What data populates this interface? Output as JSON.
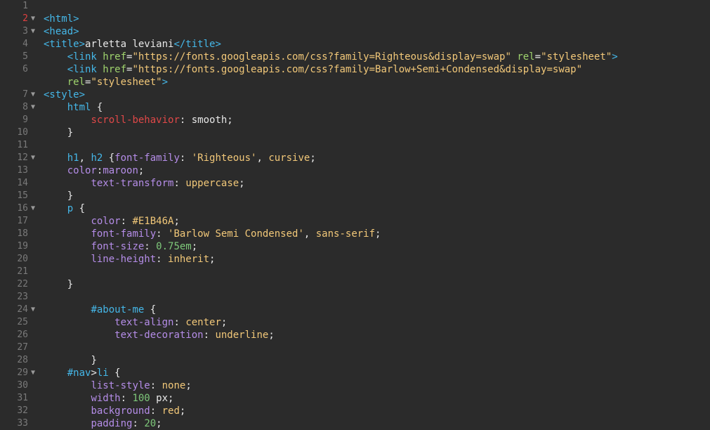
{
  "editor": {
    "active_line": 2,
    "lines": [
      {
        "n": "1",
        "fold": false,
        "indent": 0,
        "tokens": []
      },
      {
        "n": "2",
        "fold": true,
        "indent": 0,
        "tokens": [
          {
            "t": "tag",
            "v": "<html>"
          }
        ]
      },
      {
        "n": "3",
        "fold": true,
        "indent": 0,
        "tokens": [
          {
            "t": "tag",
            "v": "<head>"
          }
        ]
      },
      {
        "n": "4",
        "fold": false,
        "indent": 0,
        "tokens": [
          {
            "t": "tag",
            "v": "<title>"
          },
          {
            "t": "text",
            "v": "arletta leviani"
          },
          {
            "t": "tag",
            "v": "</title>"
          }
        ]
      },
      {
        "n": "5",
        "fold": false,
        "indent": 4,
        "tokens": [
          {
            "t": "tag",
            "v": "<link "
          },
          {
            "t": "attr",
            "v": "href"
          },
          {
            "t": "plain",
            "v": "="
          },
          {
            "t": "str",
            "v": "\"https://fonts.googleapis.com/css?family=Righteous&display=swap\""
          },
          {
            "t": "plain",
            "v": " "
          },
          {
            "t": "attr",
            "v": "rel"
          },
          {
            "t": "plain",
            "v": "="
          },
          {
            "t": "str",
            "v": "\"stylesheet\""
          },
          {
            "t": "tag",
            "v": ">"
          }
        ]
      },
      {
        "n": "6",
        "fold": false,
        "indent": 4,
        "tokens": [
          {
            "t": "tag",
            "v": "<link "
          },
          {
            "t": "attr",
            "v": "href"
          },
          {
            "t": "plain",
            "v": "="
          },
          {
            "t": "str",
            "v": "\"https://fonts.googleapis.com/css?family=Barlow+Semi+Condensed&display=swap\""
          }
        ]
      },
      {
        "n": "",
        "fold": false,
        "indent": 4,
        "tokens": [
          {
            "t": "attr",
            "v": "rel"
          },
          {
            "t": "plain",
            "v": "="
          },
          {
            "t": "str",
            "v": "\"stylesheet\""
          },
          {
            "t": "tag",
            "v": ">"
          }
        ]
      },
      {
        "n": "7",
        "fold": true,
        "indent": 0,
        "tokens": [
          {
            "t": "tag",
            "v": "<style>"
          }
        ]
      },
      {
        "n": "8",
        "fold": true,
        "indent": 4,
        "tokens": [
          {
            "t": "sel",
            "v": "html"
          },
          {
            "t": "plain",
            "v": " {"
          }
        ]
      },
      {
        "n": "9",
        "fold": false,
        "indent": 8,
        "tokens": [
          {
            "t": "propred",
            "v": "scroll-behavior"
          },
          {
            "t": "plain",
            "v": ": smooth;"
          }
        ]
      },
      {
        "n": "10",
        "fold": false,
        "indent": 4,
        "tokens": [
          {
            "t": "plain",
            "v": "}"
          }
        ]
      },
      {
        "n": "11",
        "fold": false,
        "indent": 0,
        "tokens": []
      },
      {
        "n": "12",
        "fold": true,
        "indent": 4,
        "tokens": [
          {
            "t": "sel",
            "v": "h1"
          },
          {
            "t": "plain",
            "v": ", "
          },
          {
            "t": "sel",
            "v": "h2"
          },
          {
            "t": "plain",
            "v": " {"
          },
          {
            "t": "prop",
            "v": "font-family"
          },
          {
            "t": "plain",
            "v": ": "
          },
          {
            "t": "val",
            "v": "'Righteous'"
          },
          {
            "t": "plain",
            "v": ", "
          },
          {
            "t": "val",
            "v": "cursive"
          },
          {
            "t": "plain",
            "v": ";"
          }
        ]
      },
      {
        "n": "13",
        "fold": false,
        "indent": 4,
        "tokens": [
          {
            "t": "prop",
            "v": "color"
          },
          {
            "t": "plain",
            "v": ":"
          },
          {
            "t": "prop",
            "v": "maroon"
          },
          {
            "t": "plain",
            "v": ";"
          }
        ]
      },
      {
        "n": "14",
        "fold": false,
        "indent": 8,
        "tokens": [
          {
            "t": "prop",
            "v": "text-transform"
          },
          {
            "t": "plain",
            "v": ": "
          },
          {
            "t": "val",
            "v": "uppercase"
          },
          {
            "t": "plain",
            "v": ";"
          }
        ]
      },
      {
        "n": "15",
        "fold": false,
        "indent": 4,
        "tokens": [
          {
            "t": "plain",
            "v": "}"
          }
        ]
      },
      {
        "n": "16",
        "fold": true,
        "indent": 4,
        "tokens": [
          {
            "t": "sel",
            "v": "p"
          },
          {
            "t": "plain",
            "v": " {"
          }
        ]
      },
      {
        "n": "17",
        "fold": false,
        "indent": 8,
        "tokens": [
          {
            "t": "prop",
            "v": "color"
          },
          {
            "t": "plain",
            "v": ": "
          },
          {
            "t": "val",
            "v": "#E1B46A"
          },
          {
            "t": "plain",
            "v": ";"
          }
        ]
      },
      {
        "n": "18",
        "fold": false,
        "indent": 8,
        "tokens": [
          {
            "t": "prop",
            "v": "font-family"
          },
          {
            "t": "plain",
            "v": ": "
          },
          {
            "t": "val",
            "v": "'Barlow Semi Condensed'"
          },
          {
            "t": "plain",
            "v": ", "
          },
          {
            "t": "val",
            "v": "sans-serif"
          },
          {
            "t": "plain",
            "v": ";"
          }
        ]
      },
      {
        "n": "19",
        "fold": false,
        "indent": 8,
        "tokens": [
          {
            "t": "prop",
            "v": "font-size"
          },
          {
            "t": "plain",
            "v": ": "
          },
          {
            "t": "num",
            "v": "0.75em"
          },
          {
            "t": "plain",
            "v": ";"
          }
        ]
      },
      {
        "n": "20",
        "fold": false,
        "indent": 8,
        "tokens": [
          {
            "t": "prop",
            "v": "line-height"
          },
          {
            "t": "plain",
            "v": ": "
          },
          {
            "t": "val",
            "v": "inherit"
          },
          {
            "t": "plain",
            "v": ";"
          }
        ]
      },
      {
        "n": "21",
        "fold": false,
        "indent": 0,
        "tokens": []
      },
      {
        "n": "22",
        "fold": false,
        "indent": 4,
        "tokens": [
          {
            "t": "plain",
            "v": "}"
          }
        ]
      },
      {
        "n": "23",
        "fold": false,
        "indent": 0,
        "tokens": []
      },
      {
        "n": "24",
        "fold": true,
        "indent": 8,
        "tokens": [
          {
            "t": "sel",
            "v": "#about-me"
          },
          {
            "t": "plain",
            "v": " {"
          }
        ]
      },
      {
        "n": "25",
        "fold": false,
        "indent": 12,
        "tokens": [
          {
            "t": "prop",
            "v": "text-align"
          },
          {
            "t": "plain",
            "v": ": "
          },
          {
            "t": "val",
            "v": "center"
          },
          {
            "t": "plain",
            "v": ";"
          }
        ]
      },
      {
        "n": "26",
        "fold": false,
        "indent": 12,
        "tokens": [
          {
            "t": "prop",
            "v": "text-decoration"
          },
          {
            "t": "plain",
            "v": ": "
          },
          {
            "t": "val",
            "v": "underline"
          },
          {
            "t": "plain",
            "v": ";"
          }
        ]
      },
      {
        "n": "27",
        "fold": false,
        "indent": 0,
        "tokens": []
      },
      {
        "n": "28",
        "fold": false,
        "indent": 8,
        "tokens": [
          {
            "t": "plain",
            "v": "}"
          }
        ]
      },
      {
        "n": "29",
        "fold": true,
        "indent": 4,
        "tokens": [
          {
            "t": "sel",
            "v": "#nav"
          },
          {
            "t": "plain",
            "v": ">"
          },
          {
            "t": "sel",
            "v": "li"
          },
          {
            "t": "plain",
            "v": " {"
          }
        ]
      },
      {
        "n": "30",
        "fold": false,
        "indent": 8,
        "tokens": [
          {
            "t": "prop",
            "v": "list-style"
          },
          {
            "t": "plain",
            "v": ": "
          },
          {
            "t": "val",
            "v": "none"
          },
          {
            "t": "plain",
            "v": ";"
          }
        ]
      },
      {
        "n": "31",
        "fold": false,
        "indent": 8,
        "tokens": [
          {
            "t": "prop",
            "v": "width"
          },
          {
            "t": "plain",
            "v": ": "
          },
          {
            "t": "num",
            "v": "100"
          },
          {
            "t": "plain",
            "v": " px;"
          }
        ]
      },
      {
        "n": "32",
        "fold": false,
        "indent": 8,
        "tokens": [
          {
            "t": "prop",
            "v": "background"
          },
          {
            "t": "plain",
            "v": ": "
          },
          {
            "t": "val",
            "v": "red"
          },
          {
            "t": "plain",
            "v": ";"
          }
        ]
      },
      {
        "n": "33",
        "fold": false,
        "indent": 8,
        "tokens": [
          {
            "t": "prop",
            "v": "padding"
          },
          {
            "t": "plain",
            "v": ": "
          },
          {
            "t": "num",
            "v": "20"
          },
          {
            "t": "plain",
            "v": ";"
          }
        ]
      }
    ]
  }
}
